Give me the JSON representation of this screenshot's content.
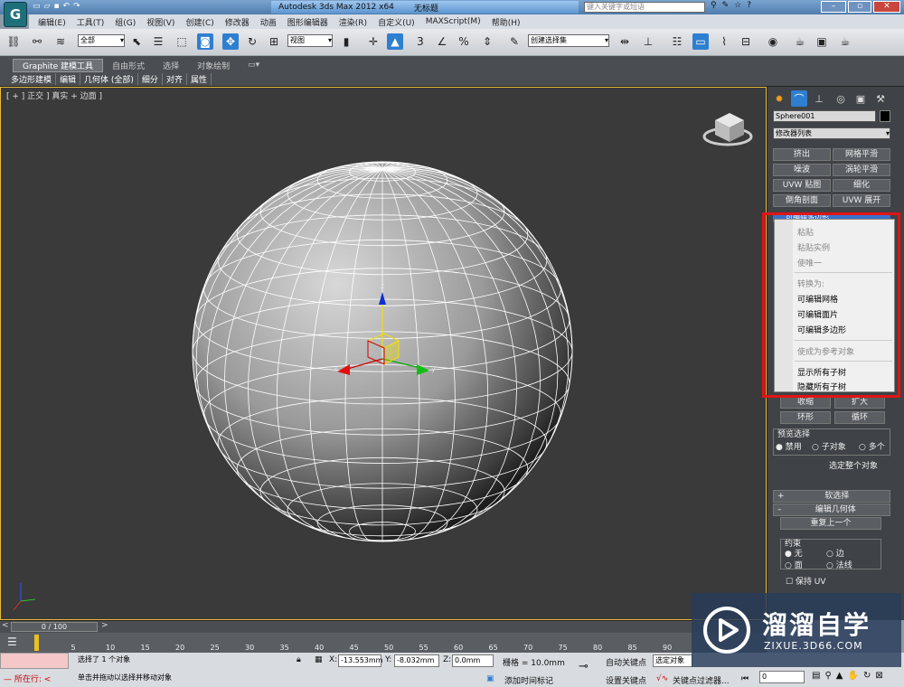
{
  "title_bar": {
    "app_title": "Autodesk 3ds Max  2012 x64",
    "file_title": "无标题",
    "search_placeholder": "键入关键字或短语",
    "logo_letter": "G"
  },
  "menu": [
    "编辑(E)",
    "工具(T)",
    "组(G)",
    "视图(V)",
    "创建(C)",
    "修改器",
    "动画",
    "图形编辑器",
    "渲染(R)",
    "自定义(U)",
    "MAXScript(M)",
    "帮助(H)"
  ],
  "toolbar": {
    "selection_filter": "全部",
    "reference_coord": "视图",
    "named_selection": "创建选择集",
    "snap_label": "3",
    "angle_snap": "%"
  },
  "ribbon": {
    "tabs": [
      "Graphite 建模工具",
      "自由形式",
      "选择",
      "对象绘制"
    ],
    "subtabs": [
      "多边形建模",
      "编辑",
      "几何体 (全部)",
      "细分",
      "对齐",
      "属性"
    ]
  },
  "viewport": {
    "label": "[ + ] 正交 ] 真实 + 边面 ]",
    "gizmo_axes": [
      "x",
      "y",
      "z"
    ]
  },
  "panel": {
    "object_name": "Sphere001",
    "modifier_list": "修改器列表",
    "modifier_buttons": [
      "挤出",
      "网格平滑",
      "噪波",
      "涡轮平滑",
      "UVW 贴图",
      "细化",
      "倒角剖面",
      "UVW 展开"
    ],
    "stack_item": "可编辑多边形",
    "shrink_label": "收缩",
    "grow_label": "扩大",
    "ring_label": "环形",
    "loop_label": "循环",
    "preview_group": "预览选择",
    "preview_options": [
      "禁用",
      "子对象",
      "多个"
    ],
    "select_whole": "选定整个对象",
    "soft_select": "软选择",
    "edit_geometry": "编辑几何体",
    "repeat_last": "重复上一个",
    "constraints_group": "约束",
    "constraint_options": [
      "无",
      "边",
      "面",
      "法线"
    ],
    "preserve_uv": "保持 UV"
  },
  "context_menu": {
    "items_disabled_top": [
      "粘贴",
      "粘贴实例",
      "使唯一"
    ],
    "convert_header": "转换为:",
    "convert_items": [
      "可编辑网格",
      "可编辑面片",
      "可编辑多边形"
    ],
    "make_reference": "使成为参考对象",
    "show_all": "显示所有子树",
    "hide_all": "隐藏所有子树"
  },
  "timeline": {
    "frame_display": "0 / 100",
    "ticks": [
      "0",
      "5",
      "10",
      "15",
      "20",
      "25",
      "30",
      "35",
      "40",
      "45",
      "50",
      "55",
      "60",
      "65",
      "70",
      "75",
      "80",
      "85",
      "90"
    ]
  },
  "status": {
    "selection_msg": "选择了 1 个对象",
    "hint_msg": "单击并拖动以选择并移动对象",
    "listener_label": "所在行:",
    "x_label": "X:",
    "x_value": "-13.553mm",
    "y_label": "Y:",
    "y_value": "-8.032mm",
    "z_label": "Z:",
    "z_value": "0.0mm",
    "grid_value": "栅格 = 10.0mm",
    "auto_key": "自动关键点",
    "set_key": "设置关键点",
    "selected_dropdown": "选定对象",
    "add_time_tag": "添加时间标记",
    "key_filters": "关键点过滤器...",
    "frame_field": "0"
  },
  "watermark": {
    "brand": "溜溜自学",
    "url": "ZIXUE.3D66.COM"
  }
}
